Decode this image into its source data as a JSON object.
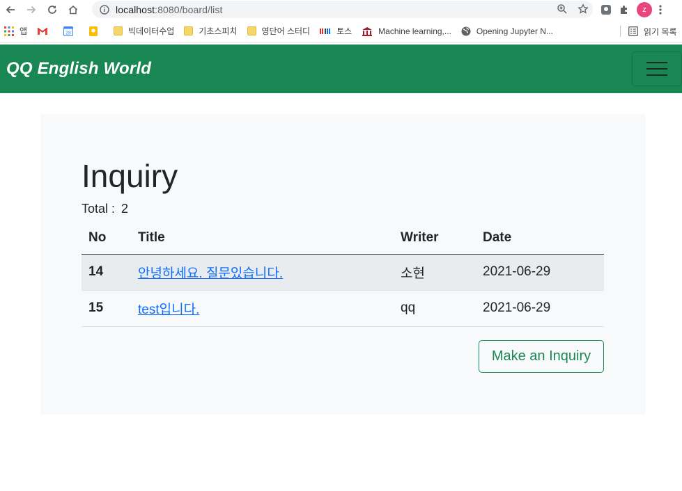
{
  "browser": {
    "url_host": "localhost",
    "url_path": ":8080/board/list",
    "profile_initial": "z",
    "bookmarks": [
      {
        "label": "앱",
        "icon": "apps-grid-icon"
      },
      {
        "label": "",
        "icon": "gmail-icon"
      },
      {
        "label": "",
        "icon": "calendar-icon"
      },
      {
        "label": "",
        "icon": "keep-icon"
      },
      {
        "label": "빅데이터수업",
        "icon": "folder-icon"
      },
      {
        "label": "기초스피치",
        "icon": "folder-icon"
      },
      {
        "label": "영단어 스터디",
        "icon": "folder-icon"
      },
      {
        "label": "토스",
        "icon": "toss-icon"
      },
      {
        "label": "Machine learning,...",
        "icon": "university-icon"
      },
      {
        "label": "Opening Jupyter N...",
        "icon": "globe-icon"
      }
    ],
    "reading_list": "읽기 목록"
  },
  "site": {
    "brand": "QQ English World"
  },
  "page": {
    "title": "Inquiry",
    "total_label": "Total :",
    "total_value": "2",
    "columns": [
      "No",
      "Title",
      "Writer",
      "Date"
    ],
    "rows": [
      {
        "no": "14",
        "title": "안녕하세요. 질문있습니다.",
        "writer": "소현",
        "date": "2021-06-29"
      },
      {
        "no": "15",
        "title": "test입니다.",
        "writer": "qq",
        "date": "2021-06-29"
      }
    ],
    "action_button": "Make an Inquiry"
  },
  "colors": {
    "navbar": "#198754",
    "link": "#0d6efd",
    "card": "#f8f9fa"
  }
}
